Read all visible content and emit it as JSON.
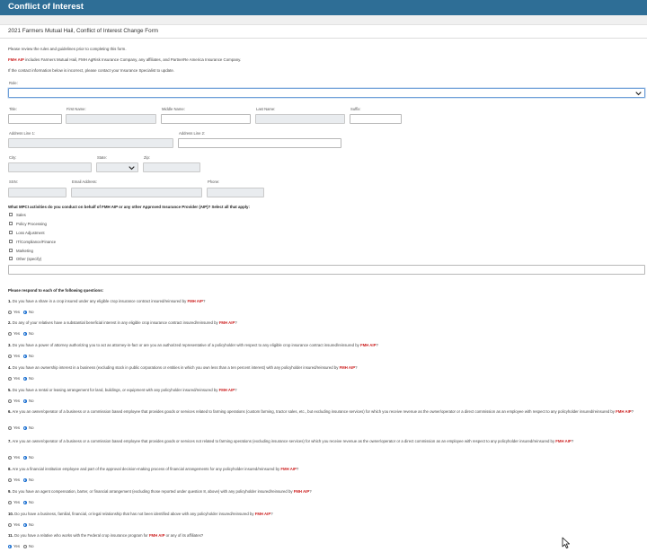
{
  "header": {
    "title": "Conflict of Interest"
  },
  "form": {
    "title": "2021 Farmers Mutual Hail, Conflict of Interest Change Form",
    "intro": "Please review the rules and guidelines prior to completing this form.",
    "fmh_aip": "FMH AIP",
    "fmh_def": " includes Farmers Mutual Hail, FMH AgRisk Insurance Company, any affiliates, and PartnerRe America Insurance Company.",
    "contact_note": "If the contact information below is incorrect, please contact your Insurance Specialist to update.",
    "role_label": "Role:",
    "role_value": "",
    "labels": {
      "title": "Title:",
      "first_name": "First Name:",
      "middle_name": "Middle Name:",
      "last_name": "Last Name:",
      "suffix": "Suffix:",
      "address1": "Address Line 1:",
      "address2": "Address Line 2:",
      "city": "City:",
      "state": "State:",
      "zip": "Zip:",
      "ssn": "SSN:",
      "email": "Email Address:",
      "phone": "Phone:"
    }
  },
  "activities": {
    "heading": "What MPCI activities do you conduct on behalf of FMH AIP or any other Approved Insurance Provider (AIP)? Select all that apply:",
    "options": [
      "Sales",
      "Policy Processing",
      "Loss Adjustment",
      "IT/Compliance/Finance",
      "Marketing",
      "Other (specify)"
    ],
    "other_value": ""
  },
  "questions": {
    "heading": "Please respond to each of the following questions:",
    "yes_label": "Yes",
    "no_label": "No",
    "items": [
      {
        "num": "1.",
        "text": " Do you have a share in a crop insured under any eligible crop insurance contract insured/reinsured by ",
        "tail": "?",
        "selected": "No"
      },
      {
        "num": "2.",
        "text": " Do any of your relatives have a substantial beneficial interest in any eligible crop insurance contract insured/reinsured by ",
        "tail": "?",
        "selected": "No"
      },
      {
        "num": "3.",
        "text": " Do you have a power of attorney authorizing you to act as attorney-in-fact or are you an authorized representative of a policyholder with respect to any eligible crop insurance contract insured/reinsured by ",
        "tail": "?",
        "selected": "No"
      },
      {
        "num": "4.",
        "text": " Do you have an ownership interest in a business (excluding stock in public corporations or entities in which you own less than a ten percent interest) with any policyholder insured/reinsured by ",
        "tail": "?",
        "selected": "No"
      },
      {
        "num": "5.",
        "text": " Do you have a rental or leasing arrangement for land, buildings, or equipment with any policyholder insured/reinsured by ",
        "tail": "?",
        "selected": "No"
      },
      {
        "num": "6.",
        "text": " Are you an owner/operator of a business or a commission based employee that provides goods or services related to farming operations (custom farming, tractor sales, etc., but excluding insurance services) for which you receive revenue as the owner/operator or a direct commission as an employee with respect to any policyholder insured/reinsured by ",
        "tail": "?",
        "selected": "No"
      },
      {
        "num": "7.",
        "text": " Are you an owner/operator of a business or a commission based employee that provides goods or services not related to farming operations (excluding insurance services) for which you receive revenue as the owner/operator or a direct commission as an employee with respect to any policyholder insured/reinsured by ",
        "tail": "?",
        "selected": "No"
      },
      {
        "num": "8.",
        "text": " Are you a financial institution employee and part of the approval decision-making process of financial arrangements for any policyholder insured/reinsured by ",
        "tail": "?",
        "selected": "No"
      },
      {
        "num": "9.",
        "text": " Do you have an agent compensation, barter, or financial arrangement (excluding those reported under question 8, above) with any policyholder insured/reinsured by ",
        "tail": "?",
        "selected": "No"
      },
      {
        "num": "10.",
        "text": " Do you have a business, familial, financial, or legal relationship that has not been identified above with any policyholder insured/reinsured by ",
        "tail": "?",
        "selected": "No"
      },
      {
        "num": "11.",
        "text": " Do you have a relative who works with the Federal crop insurance program for ",
        "tail": " or any of its affiliates?",
        "selected": "Yes"
      }
    ]
  },
  "colors": {
    "header_bg": "#2e6e96",
    "accent_red": "#cc1f1f",
    "radio_blue": "#1a6fd1"
  },
  "icons": {
    "select_arrow": "chevron-down-icon",
    "pointer": "mouse-pointer-icon"
  }
}
